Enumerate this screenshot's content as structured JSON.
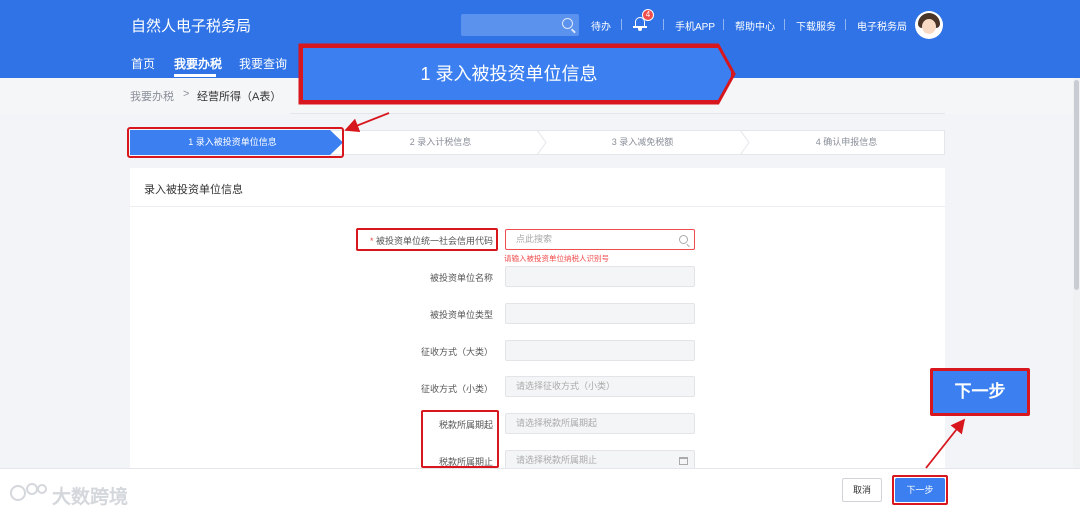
{
  "header": {
    "title": "自然人电子税务局",
    "search_placeholder": "",
    "todo_label": "待办",
    "notification_count": "4",
    "links": [
      "手机APP",
      "帮助中心",
      "下载服务",
      "电子税务局"
    ]
  },
  "nav": {
    "items": [
      "首页",
      "我要办税",
      "我要查询"
    ],
    "active_index": 1
  },
  "breadcrumb": {
    "root": "我要办税",
    "separator": ">",
    "current": "经营所得（A表）"
  },
  "steps": [
    {
      "label": "1  录入被投资单位信息",
      "active": true
    },
    {
      "label": "2  录入计税信息",
      "active": false
    },
    {
      "label": "3  录入减免税额",
      "active": false
    },
    {
      "label": "4  确认申报信息",
      "active": false
    }
  ],
  "panel": {
    "title": "录入被投资单位信息",
    "fields": [
      {
        "label": "被投资单位统一社会信用代码",
        "required": true,
        "placeholder": "点此搜索",
        "icon": "search-icon"
      },
      {
        "label": "被投资单位名称",
        "required": false,
        "placeholder": ""
      },
      {
        "label": "被投资单位类型",
        "required": false,
        "placeholder": ""
      },
      {
        "label": "征收方式（大类）",
        "required": false,
        "placeholder": ""
      },
      {
        "label": "征收方式（小类）",
        "required": false,
        "placeholder": "请选择征收方式（小类）"
      },
      {
        "label": "税款所属期起",
        "required": false,
        "placeholder": "请选择税款所属期起"
      },
      {
        "label": "税款所属期止",
        "required": false,
        "placeholder": "请选择税款所属期止",
        "icon": "calendar-icon"
      }
    ],
    "error_text": "请输入被投资单位纳税人识别号"
  },
  "footer": {
    "cancel_label": "取消",
    "next_label": "下一步"
  },
  "annotations": {
    "zoom_step_label": "1  录入被投资单位信息",
    "zoom_next_label": "下一步",
    "highlight_color": "#d7161d"
  },
  "watermark": {
    "text": "大数跨境"
  },
  "colors": {
    "primary": "#2f73e6",
    "accent": "#3b7ff0",
    "error": "#f04c4c"
  }
}
